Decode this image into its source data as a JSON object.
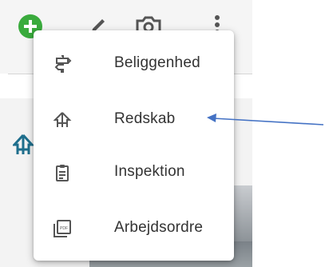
{
  "toolbar": {
    "icons": [
      "add-icon",
      "pencil-icon",
      "camera-icon",
      "more-vert-icon"
    ],
    "add_color": "#3aab3d"
  },
  "background": {
    "tree_icon": "tree-icon",
    "tree_color": "#1e6e8c"
  },
  "menu": {
    "items": [
      {
        "label": "Beliggenhed",
        "icon": "signpost-icon"
      },
      {
        "label": "Redskab",
        "icon": "equipment-icon"
      },
      {
        "label": "Inspektion",
        "icon": "clipboard-icon"
      },
      {
        "label": "Arbejdsordre",
        "icon": "pdf-icon"
      }
    ]
  },
  "annotation": {
    "arrow_color": "#4472c4"
  }
}
